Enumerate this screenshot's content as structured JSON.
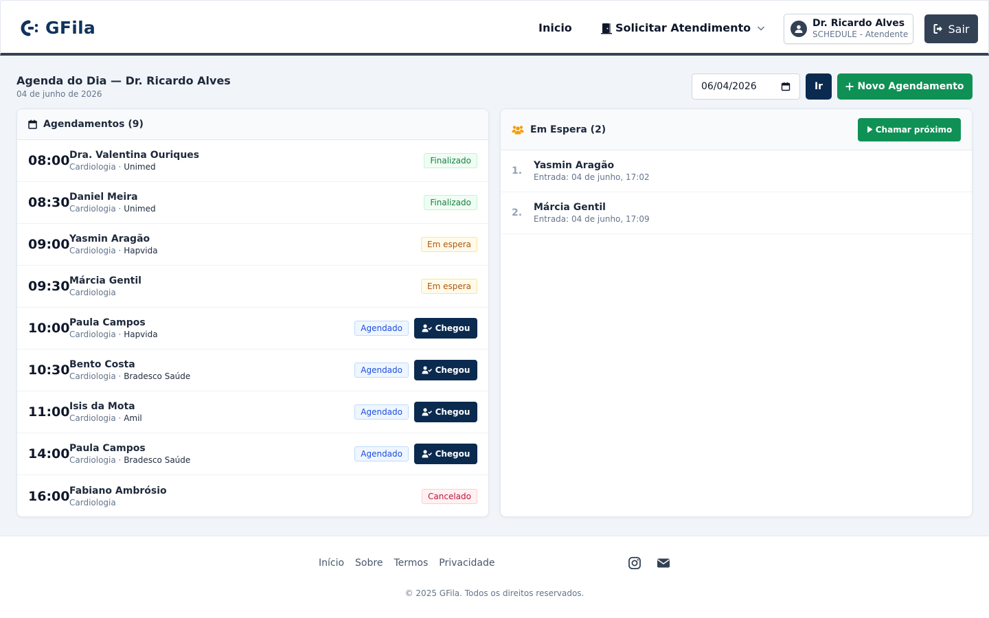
{
  "brand": {
    "name": "GFila",
    "color": "#10335e"
  },
  "nav": {
    "home_label": "Inicio",
    "request_label": "Solicitar Atendimento"
  },
  "user": {
    "name": "Dr. Ricardo Alves",
    "role": "SCHEDULE - Atendente",
    "logout_label": "Sair"
  },
  "page": {
    "title": "Agenda do Dia — Dr. Ricardo Alves",
    "date_long": "04 de junho de 2026",
    "date_input": "06/04/2026",
    "go_label": "Ir",
    "new_label": "Novo Agendamento"
  },
  "appointments": {
    "title": "Agendamentos (9)",
    "arrive_label": "Chegou",
    "rows": [
      {
        "time": "08:00",
        "name": "Dra. Valentina Ouriques",
        "specialty": "Cardiologia",
        "sep": " · ",
        "insurance": "Unimed",
        "status": "Finalizado"
      },
      {
        "time": "08:30",
        "name": "Daniel Meira",
        "specialty": "Cardiologia",
        "sep": " · ",
        "insurance": "Unimed",
        "status": "Finalizado"
      },
      {
        "time": "09:00",
        "name": "Yasmin Aragão",
        "specialty": "Cardiologia",
        "sep": " · ",
        "insurance": "Hapvida",
        "status": "Em espera"
      },
      {
        "time": "09:30",
        "name": "Márcia Gentil",
        "specialty": "Cardiologia",
        "sep": "",
        "insurance": "",
        "status": "Em espera"
      },
      {
        "time": "10:00",
        "name": "Paula Campos",
        "specialty": "Cardiologia",
        "sep": " · ",
        "insurance": "Hapvida",
        "status": "Agendado"
      },
      {
        "time": "10:30",
        "name": "Bento Costa",
        "specialty": "Cardiologia",
        "sep": " · ",
        "insurance": "Bradesco Saúde",
        "status": "Agendado"
      },
      {
        "time": "11:00",
        "name": "Isis da Mota",
        "specialty": "Cardiologia",
        "sep": " · ",
        "insurance": "Amil",
        "status": "Agendado"
      },
      {
        "time": "14:00",
        "name": "Paula Campos",
        "specialty": "Cardiologia",
        "sep": " · ",
        "insurance": "Bradesco Saúde",
        "status": "Agendado"
      },
      {
        "time": "16:00",
        "name": "Fabiano Ambrósio",
        "specialty": "Cardiologia",
        "sep": "",
        "insurance": "",
        "status": "Cancelado"
      }
    ]
  },
  "waiting": {
    "title": "Em Espera (2)",
    "call_label": "Chamar próximo",
    "rows": [
      {
        "num": "1.",
        "name": "Yasmin Aragão",
        "entry": "Entrada: 04 de junho, 17:02"
      },
      {
        "num": "2.",
        "name": "Márcia Gentil",
        "entry": "Entrada: 04 de junho, 17:09"
      }
    ]
  },
  "footer": {
    "links": [
      "Início",
      "Sobre",
      "Termos",
      "Privacidade"
    ],
    "copyright": "© 2025 GFila. Todos os direitos reservados."
  },
  "colors": {
    "primary": "#0b2a4f",
    "success": "#0f9155",
    "header_border": "#334155",
    "waiting_icon": "#f59e0b"
  }
}
